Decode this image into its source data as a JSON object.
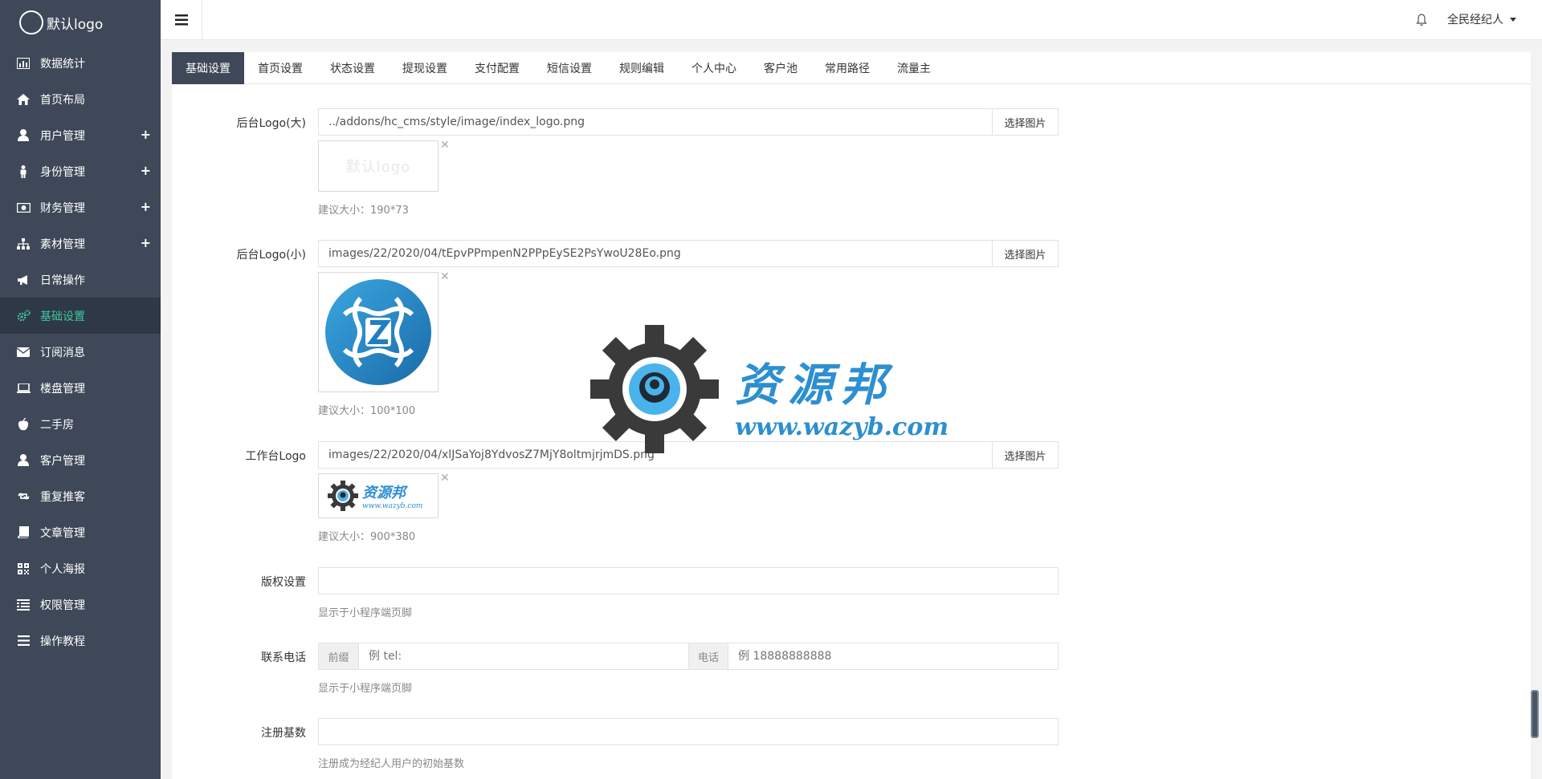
{
  "app": {
    "logo_text": "默认logo"
  },
  "sidebar": {
    "items": [
      {
        "label": "数据统计",
        "icon": "bar-chart-icon",
        "expandable": false,
        "active": false
      },
      {
        "label": "首页布局",
        "icon": "home-icon",
        "expandable": false,
        "active": false
      },
      {
        "label": "用户管理",
        "icon": "user-icon",
        "expandable": true,
        "active": false
      },
      {
        "label": "身份管理",
        "icon": "person-icon",
        "expandable": true,
        "active": false
      },
      {
        "label": "财务管理",
        "icon": "money-icon",
        "expandable": true,
        "active": false
      },
      {
        "label": "素材管理",
        "icon": "sitemap-icon",
        "expandable": true,
        "active": false
      },
      {
        "label": "日常操作",
        "icon": "bullhorn-icon",
        "expandable": false,
        "active": false
      },
      {
        "label": "基础设置",
        "icon": "gears-icon",
        "expandable": false,
        "active": true
      },
      {
        "label": "订阅消息",
        "icon": "envelope-icon",
        "expandable": false,
        "active": false
      },
      {
        "label": "楼盘管理",
        "icon": "laptop-icon",
        "expandable": false,
        "active": false
      },
      {
        "label": "二手房",
        "icon": "apple-icon",
        "expandable": false,
        "active": false
      },
      {
        "label": "客户管理",
        "icon": "user-icon",
        "expandable": false,
        "active": false
      },
      {
        "label": "重复推客",
        "icon": "retweet-icon",
        "expandable": false,
        "active": false
      },
      {
        "label": "文章管理",
        "icon": "book-icon",
        "expandable": false,
        "active": false
      },
      {
        "label": "个人海报",
        "icon": "qrcode-icon",
        "expandable": false,
        "active": false
      },
      {
        "label": "权限管理",
        "icon": "list-alt-icon",
        "expandable": false,
        "active": false
      },
      {
        "label": "操作教程",
        "icon": "bars-icon",
        "expandable": false,
        "active": false
      }
    ]
  },
  "topbar": {
    "user_name": "全民经纪人"
  },
  "tabs": [
    {
      "label": "基础设置",
      "active": true
    },
    {
      "label": "首页设置",
      "active": false
    },
    {
      "label": "状态设置",
      "active": false
    },
    {
      "label": "提现设置",
      "active": false
    },
    {
      "label": "支付配置",
      "active": false
    },
    {
      "label": "短信设置",
      "active": false
    },
    {
      "label": "规则编辑",
      "active": false
    },
    {
      "label": "个人中心",
      "active": false
    },
    {
      "label": "客户池",
      "active": false
    },
    {
      "label": "常用路径",
      "active": false
    },
    {
      "label": "流量主",
      "active": false
    }
  ],
  "form": {
    "logo_big": {
      "label": "后台Logo(大)",
      "value": "../addons/hc_cms/style/image/index_logo.png",
      "button": "选择图片",
      "preview_text": "默认logo",
      "help": "建议大小：190*73"
    },
    "logo_small": {
      "label": "后台Logo(小)",
      "value": "images/22/2020/04/tEpvPPmpenN2PPpEySE2PsYwoU28Eo.png",
      "button": "选择图片",
      "help": "建议大小：100*100"
    },
    "workbench_logo": {
      "label": "工作台Logo",
      "value": "images/22/2020/04/xlJSaYoj8YdvosZ7MjY8oltmjrjmDS.png",
      "button": "选择图片",
      "preview_title": "资源邦",
      "preview_url": "www.wazyb.com",
      "help": "建议大小：900*380"
    },
    "copyright": {
      "label": "版权设置",
      "value": "",
      "help": "显示于小程序端页脚"
    },
    "phone": {
      "label": "联系电话",
      "prefix_addon": "前缀",
      "prefix_placeholder": "例 tel:",
      "number_addon": "电话",
      "number_placeholder": "例 18888888888",
      "help": "显示于小程序端页脚"
    },
    "register_base": {
      "label": "注册基数",
      "value": "",
      "help": "注册成为经纪人用户的初始基数"
    }
  },
  "watermark": {
    "title": "资源邦",
    "url": "www.wazyb.com"
  },
  "colors": {
    "sidebar_bg": "#3e4858",
    "active_text": "#3cc8a0",
    "brand_blue": "#2d8fd0"
  }
}
